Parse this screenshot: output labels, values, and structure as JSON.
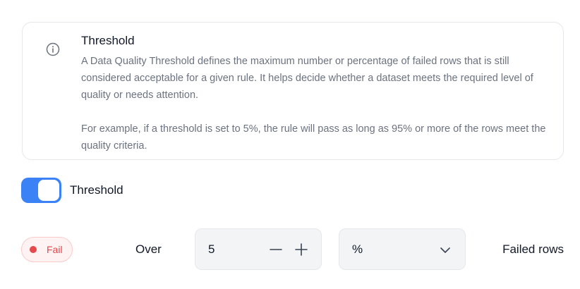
{
  "info": {
    "icon": "info-circle-icon",
    "title": "Threshold",
    "paragraph_1": "A Data Quality Threshold defines the maximum number or percentage of failed rows that is still considered acceptable for a given rule. It helps decide whether a dataset meets the required level of quality or needs attention.",
    "paragraph_2": "For example, if a threshold is set to 5%, the rule will pass as long as 95% or more of the rows meet the quality criteria."
  },
  "toggle": {
    "label": "Threshold",
    "enabled": true,
    "on_color": "#3b82f6"
  },
  "rule": {
    "status": {
      "label": "Fail",
      "color": "#e5484d"
    },
    "comparator_label": "Over",
    "value": "5",
    "minus_icon": "minus-icon",
    "plus_icon": "plus-icon",
    "unit": {
      "selected": "%",
      "icon": "chevron-down-icon"
    },
    "suffix_label": "Failed rows"
  }
}
